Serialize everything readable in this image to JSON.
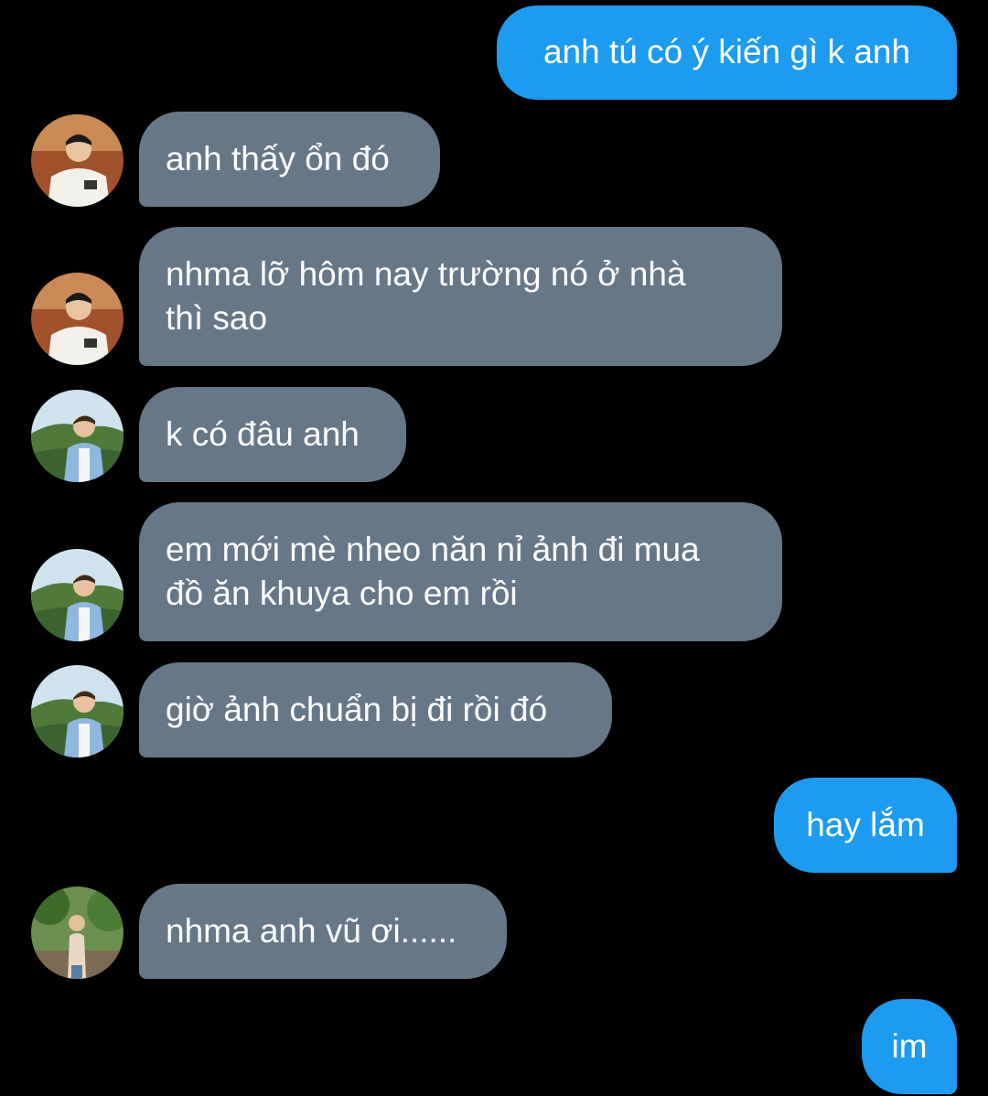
{
  "conversation": {
    "messages": [
      {
        "sender": "me",
        "lines": [
          "anh tú có ý kiến gì k anh"
        ]
      },
      {
        "sender": "contact",
        "avatar": "avatar-white-shirt",
        "lines": [
          "anh thấy ổn đó"
        ]
      },
      {
        "sender": "contact",
        "avatar": "avatar-white-shirt",
        "lines": [
          "nhma lỡ hôm nay trường nó ở nhà",
          "thì sao"
        ]
      },
      {
        "sender": "contact",
        "avatar": "avatar-mountain",
        "lines": [
          "k có đâu anh"
        ]
      },
      {
        "sender": "contact",
        "avatar": "avatar-mountain",
        "lines": [
          "em mới mè nheo năn nỉ ảnh đi mua",
          "đồ ăn khuya cho em rồi"
        ]
      },
      {
        "sender": "contact",
        "avatar": "avatar-mountain",
        "lines": [
          "giờ ảnh chuẩn bị đi rồi đó"
        ]
      },
      {
        "sender": "me",
        "lines": [
          "hay lắm"
        ]
      },
      {
        "sender": "contact",
        "avatar": "avatar-garden",
        "lines": [
          "nhma anh vũ ơi......"
        ]
      },
      {
        "sender": "me",
        "lines": [
          "im"
        ]
      }
    ]
  },
  "colors": {
    "background": "#000000",
    "outgoing_bubble": "#1d9bf0",
    "incoming_bubble": "#667788",
    "bubble_text": "#ffffff"
  }
}
